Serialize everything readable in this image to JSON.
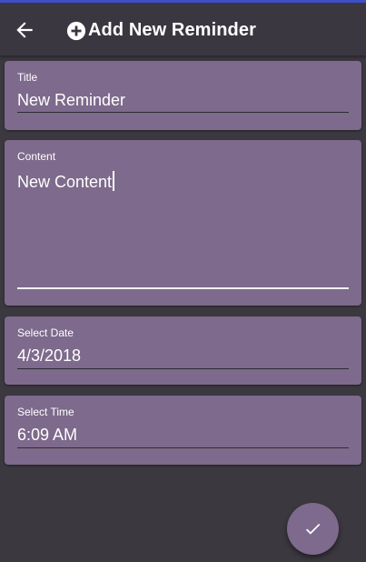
{
  "appbar": {
    "title": "Add New Reminder",
    "back_icon": "arrow-left-icon",
    "title_icon": "plus-circle-icon"
  },
  "form": {
    "title_field": {
      "label": "Title",
      "value": "New Reminder"
    },
    "content_field": {
      "label": "Content",
      "value": "New Content"
    },
    "date_field": {
      "label": "Select Date",
      "value": "4/3/2018"
    },
    "time_field": {
      "label": "Select Time",
      "value": "6:09 AM"
    }
  },
  "fab": {
    "icon": "check-icon"
  },
  "colors": {
    "background": "#3b3840",
    "card": "#7e6a8c",
    "accent_bar": "#3d4fc9",
    "text": "#ffffff"
  }
}
